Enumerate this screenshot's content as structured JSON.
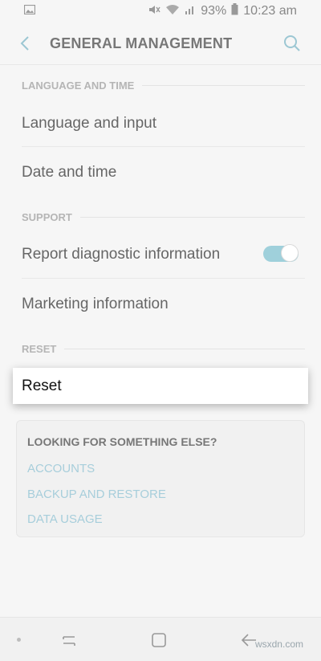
{
  "status_bar": {
    "battery_percent": "93%",
    "time": "10:23 am",
    "icons": [
      "image-icon",
      "mute-icon",
      "wifi-icon",
      "signal-icon",
      "battery-icon"
    ]
  },
  "header": {
    "title": "GENERAL MANAGEMENT",
    "back_icon": "chevron-left-icon",
    "search_icon": "search-icon"
  },
  "sections": {
    "language_time": {
      "label": "LANGUAGE AND TIME",
      "items": [
        "Language and input",
        "Date and time"
      ]
    },
    "support": {
      "label": "SUPPORT",
      "items": [
        "Report diagnostic information",
        "Marketing information"
      ],
      "diagnostic_toggle_on": true
    },
    "reset": {
      "label": "RESET",
      "item": "Reset"
    }
  },
  "looking_for": {
    "title": "LOOKING FOR SOMETHING ELSE?",
    "links": [
      "ACCOUNTS",
      "BACKUP AND RESTORE",
      "DATA USAGE"
    ]
  },
  "nav_bar": {
    "icons": [
      "dot-icon",
      "recent-apps-icon",
      "home-icon",
      "back-arrow-icon"
    ]
  },
  "watermark": "wsxdn.com",
  "colors": {
    "background": "#f6f6f6",
    "accent": "#9fd0db",
    "link": "#a7cedb"
  }
}
